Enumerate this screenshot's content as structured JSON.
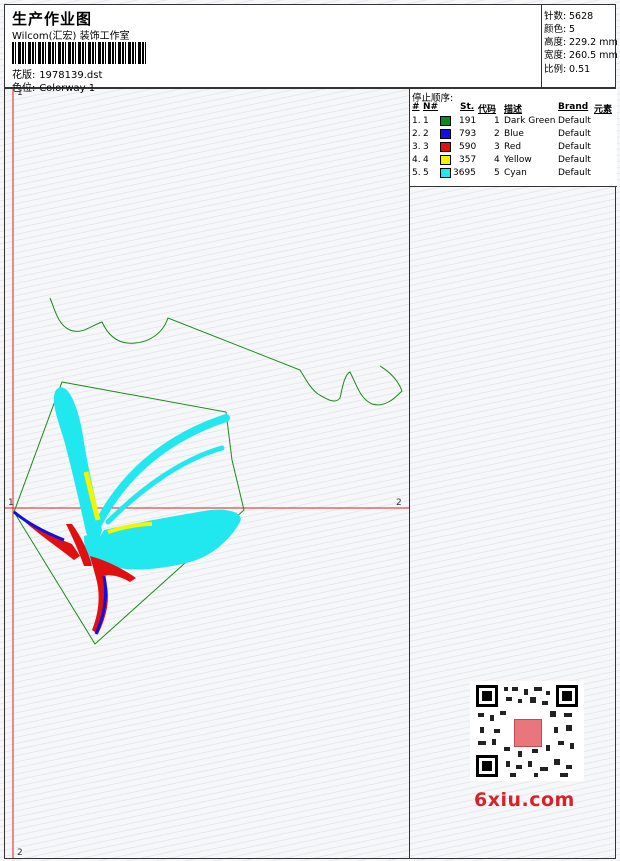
{
  "header": {
    "title": "生产作业图",
    "company": "Wilcom(汇宏) 装饰工作室",
    "design_label": "花版:",
    "design_value": "1978139.dst",
    "colorway_label": "色位:",
    "colorway_value": "Colorway 1"
  },
  "stats": [
    {
      "label": "针数:",
      "value": "5628"
    },
    {
      "label": "颜色:",
      "value": "5"
    },
    {
      "label": "高度:",
      "value": "229.2 mm"
    },
    {
      "label": "宽度:",
      "value": "260.5 mm"
    },
    {
      "label": "比例:",
      "value": "0.51"
    }
  ],
  "legend": {
    "heading": "停止顺序:",
    "columns": [
      "#",
      "N#",
      "St.",
      "代码",
      "描述",
      "Brand",
      "元素"
    ],
    "rows": [
      {
        "idx": "1.",
        "num": "1",
        "color": "#0a8a1e",
        "stitches": "191",
        "code": "1",
        "desc": "Dark Green",
        "brand": "Default"
      },
      {
        "idx": "2.",
        "num": "2",
        "color": "#1010e0",
        "stitches": "793",
        "code": "2",
        "desc": "Blue",
        "brand": "Default"
      },
      {
        "idx": "3.",
        "num": "3",
        "color": "#e01010",
        "stitches": "590",
        "code": "3",
        "desc": "Red",
        "brand": "Default"
      },
      {
        "idx": "4.",
        "num": "4",
        "color": "#f4f400",
        "stitches": "357",
        "code": "4",
        "desc": "Yellow",
        "brand": "Default"
      },
      {
        "idx": "5.",
        "num": "5",
        "color": "#20e8ee",
        "stitches": "3695",
        "code": "5",
        "desc": "Cyan",
        "brand": "Default"
      }
    ]
  },
  "markers": {
    "top": "1",
    "left": "1",
    "right": "2",
    "bottom": "2"
  },
  "watermark": {
    "site": "6xiu.com"
  },
  "colors": {
    "guide": "#e02020",
    "outline": "#1a8a1a",
    "cyan": "#20e8ee",
    "red": "#e01010",
    "blue": "#1010e0",
    "yellow": "#f4f400"
  }
}
